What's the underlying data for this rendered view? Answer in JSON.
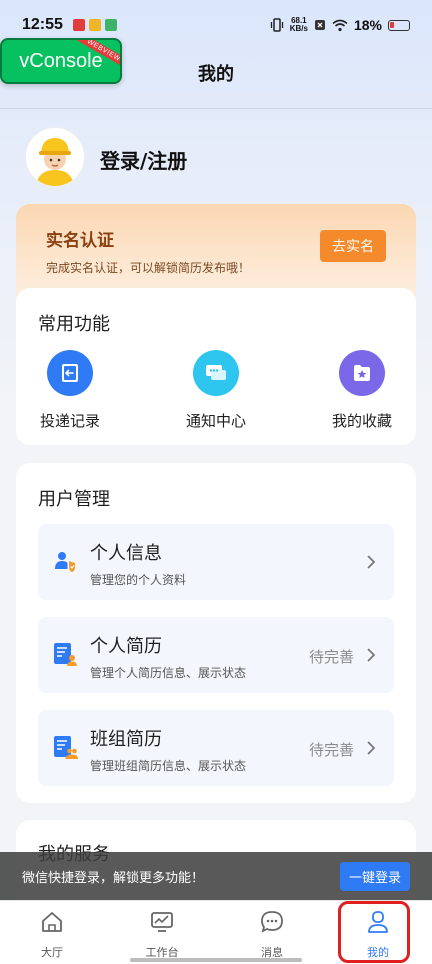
{
  "status_bar": {
    "time": "12:55",
    "net_speed_value": "68.1",
    "net_speed_unit": "KB/s",
    "battery": "18%"
  },
  "vconsole": {
    "label": "vConsole",
    "tag": "WEBVIEW"
  },
  "page": {
    "title": "我的"
  },
  "profile": {
    "login_label": "登录/注册"
  },
  "verify": {
    "title": "实名认证",
    "subtitle": "完成实名认证，可以解锁简历发布哦！",
    "button": "去实名"
  },
  "common": {
    "title": "常用功能",
    "items": [
      {
        "label": "投递记录",
        "icon": "delivery-record-icon",
        "color": "#2f7bf5"
      },
      {
        "label": "通知中心",
        "icon": "notification-icon",
        "color": "#2ec5ee"
      },
      {
        "label": "我的收藏",
        "icon": "favorites-icon",
        "color": "#7a68e8"
      }
    ]
  },
  "user_mgmt": {
    "title": "用户管理",
    "rows": [
      {
        "title": "个人信息",
        "sub": "管理您的个人资料",
        "status": ""
      },
      {
        "title": "个人简历",
        "sub": "管理个人简历信息、展示状态",
        "status": "待完善"
      },
      {
        "title": "班组简历",
        "sub": "管理班组简历信息、展示状态",
        "status": "待完善"
      }
    ]
  },
  "services": {
    "title": "我的服务"
  },
  "toast": {
    "text": "微信快捷登录，解锁更多功能！",
    "button": "一键登录"
  },
  "tabbar": {
    "tabs": [
      {
        "label": "大厅"
      },
      {
        "label": "工作台"
      },
      {
        "label": "消息"
      },
      {
        "label": "我的"
      }
    ],
    "active_color": "#2f7bf5"
  }
}
